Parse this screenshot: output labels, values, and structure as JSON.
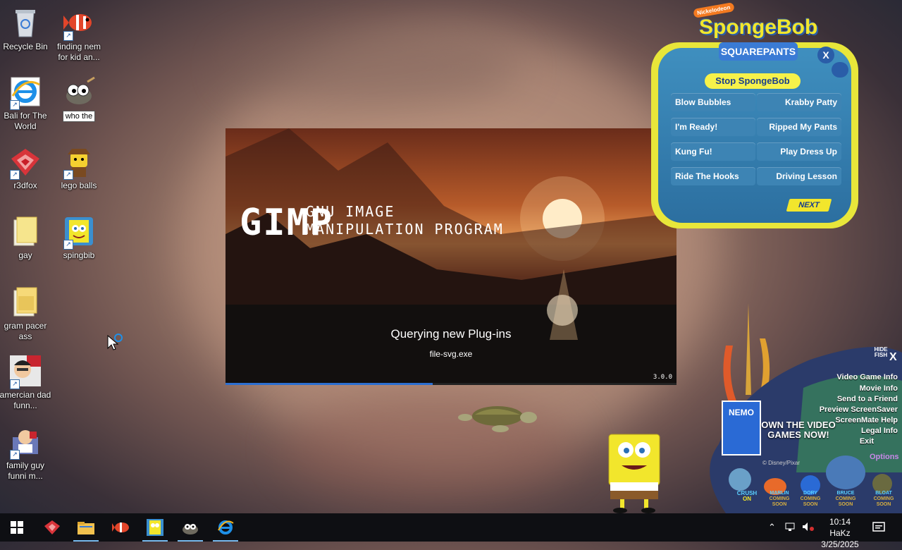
{
  "desktop": {
    "icons": [
      {
        "label": "Recycle Bin"
      },
      {
        "label": "finding nem for kid an..."
      },
      {
        "label": "Bali for The World"
      },
      {
        "label": "who the"
      },
      {
        "label": "r3dfox"
      },
      {
        "label": "lego balls"
      },
      {
        "label": "gay"
      },
      {
        "label": "spingbib"
      },
      {
        "label": "gram pacer ass"
      },
      {
        "label": "amercian dad funn..."
      },
      {
        "label": "family guy funni m..."
      }
    ]
  },
  "gimp_splash": {
    "logo": "GIMP",
    "subtitle_line1": "GNU IMAGE",
    "subtitle_line2": "MANIPULATION PROGRAM",
    "status": "Querying new Plug-ins",
    "detail": "file-svg.exe",
    "version": "3.0.0",
    "progress": 0.46
  },
  "spongebob_panel": {
    "brand": "Nickelodeon",
    "title_line1": "SpongeBob",
    "title_line2": "SQUAREPANTS",
    "stop_label": "Stop SpongeBob",
    "close_label": "X",
    "buttons": [
      "Blow Bubbles",
      "Krabby Patty",
      "I'm Ready!",
      "Ripped My Pants",
      "Kung Fu!",
      "Play Dress Up",
      "Ride The Hooks",
      "Driving Lesson"
    ],
    "next_label": "NEXT"
  },
  "nemo_panel": {
    "hide_fish": "HIDE FISH",
    "close_label": "X",
    "menu": [
      "Video Game Info",
      "Movie Info",
      "Send to a Friend",
      "Preview ScreenSaver",
      "ScreenMate Help",
      "Legal Info",
      "Exit"
    ],
    "promo": "OWN THE VIDEO GAMES NOW!",
    "box_title": "NEMO",
    "copyright": "© Disney/Pixar",
    "options": "Options",
    "characters": [
      {
        "name": "CRUSH",
        "status": "ON"
      },
      {
        "name": "MARLIN",
        "status": "COMING SOON"
      },
      {
        "name": "DORY",
        "status": "COMING SOON"
      },
      {
        "name": "BRUCE",
        "status": "COMING SOON"
      },
      {
        "name": "BLOAT",
        "status": "COMING SOON"
      }
    ]
  },
  "taskbar": {
    "time": "10:14 HaKz",
    "date": "3/25/2025",
    "pinned": [
      "start-icon",
      "r3dfox-icon",
      "file-explorer-icon",
      "fish-icon",
      "spongebob-icon",
      "gimp-icon",
      "internet-explorer-icon"
    ]
  },
  "colors": {
    "taskbar": "#0e0f13",
    "accent": "#76b9ed",
    "sponge_yellow": "#e8e63a",
    "sponge_blue": "#3d84b4"
  }
}
